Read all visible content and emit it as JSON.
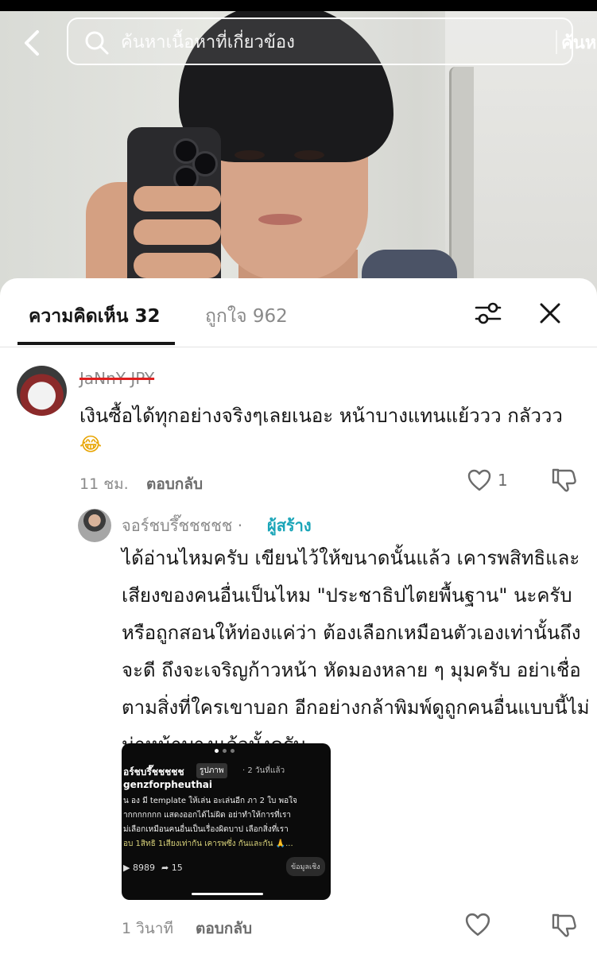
{
  "search": {
    "placeholder": "ค้นหาเนื้อหาที่เกี่ยวข้อง",
    "submit_label": "ค้นหา"
  },
  "tabs": [
    {
      "label": "ความคิดเห็น 32",
      "active": true
    },
    {
      "label": "ถูกใจ 962",
      "active": false
    }
  ],
  "icons": {
    "back": "chevron-left-icon",
    "search": "search-icon",
    "filter": "sliders-icon",
    "close": "close-icon",
    "like": "heart-icon",
    "dislike": "thumbs-down-icon",
    "emoji": "laughing-tears-emoji"
  },
  "comments": [
    {
      "username": "JaNnY JPY",
      "text": "เงินซื้อได้ทุกอย่างจริงๆเลยเนอะ หน้าบางแทนแย้ววว กลัววว",
      "emoji": "😂",
      "time": "11 ชม.",
      "reply_label": "ตอบกลับ",
      "likes": "1"
    },
    {
      "username": "จอร์ชบรึ๊ชชชชช",
      "separator": "·",
      "badge": "ผู้สร้าง",
      "text": "ได้อ่านไหมครับ เขียนไว้ให้ขนาดนั้นแล้ว เคารพสิทธิและเสียงของคนอื่นเป็นไหม \"ประชาธิปไตยพื้นฐาน\" นะครับ หรือถูกสอนให้ท่องแค่ว่า ต้องเลือกเหมือนตัวเองเท่านั้นถึงจะดี ถึงจะเจริญก้าวหน้า หัดมองหลาย ๆ มุมครับ อย่าเชื่อตามสิ่งที่ใครเขาบอก อีกอย่างกล้าพิมพ์ดูถูกคนอื่นแบบนี้ไม่น่าหน้าบางแล้วมั้งครับ",
      "time": "1 วินาที",
      "reply_label": "ตอบกลับ",
      "attachment": {
        "username": "อร์ชบรึ๊ชชชชช",
        "tag": "รูปภาพ",
        "time": "· 2 วันที่แล้ว",
        "hashtag": "genzforpheuthai",
        "lines": [
          "น อง มี template ให้เล่น อะเล่นอีก ภา 2 ใบ พอใจ",
          "ากกกกกกก แสดงออกได้ไม่ผิด อย่าทำให้การที่เรา",
          "ม่เลือกเหมือนคนอื่นเป็นเรื่องผิดบาป เลือกสิ่งที่เรา",
          "อบ 1สิทธิ 1เสียงเท่ากัน เคารพซึ่ง กันและกัน 🙏..."
        ],
        "views": "8989",
        "shares": "15",
        "more_label": "ข้อมูลเชิง"
      }
    }
  ]
}
